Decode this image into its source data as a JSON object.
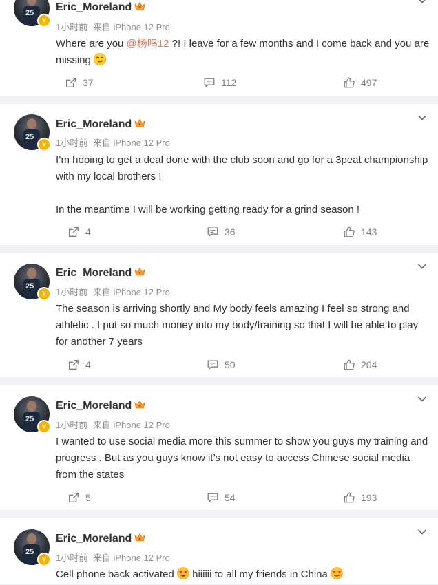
{
  "posts": [
    {
      "author": "Eric_Moreland",
      "time": "1小时前",
      "source": "来自 iPhone 12 Pro",
      "text_before": "Where are you ",
      "mention": "@杨鸣12",
      "text_after": " ?! I leave for a few months and I come back and you are missing",
      "emoji": "smirk-emoji",
      "reposts": "37",
      "comments": "112",
      "likes": "497"
    },
    {
      "author": "Eric_Moreland",
      "time": "1小时前",
      "source": "来自 iPhone 12 Pro",
      "para1": "I’m hoping to get a deal done with the club soon and go for a 3peat championship with my local brothers !",
      "para2": "In the meantime I will be working getting ready for a grind season !",
      "reposts": "4",
      "comments": "36",
      "likes": "143"
    },
    {
      "author": "Eric_Moreland",
      "time": "1小时前",
      "source": "来自 iPhone 12 Pro",
      "text": "The season is arriving shortly and My body feels amazing I feel so strong and athletic . I put so much money into my body/training so that I will be able to play for another 7 years",
      "reposts": "4",
      "comments": "50",
      "likes": "204"
    },
    {
      "author": "Eric_Moreland",
      "time": "1小时前",
      "source": "来自 iPhone 12 Pro",
      "text": "I wanted to use social media more this summer to show you guys my training and progress . But as you guys know it’s not easy to access Chinese social media from the states",
      "reposts": "5",
      "comments": "54",
      "likes": "193"
    },
    {
      "author": "Eric_Moreland",
      "time": "1小时前",
      "source": "来自 iPhone 12 Pro",
      "text_before": "Cell phone back activated ",
      "text_middle": " hiiiiii to all my friends in China ",
      "emoji1": "star-struck-emoji",
      "emoji2": "heart-eyes-emoji"
    }
  ],
  "avatar_jersey_number": "25",
  "colors": {
    "mention": "#eb7350",
    "meta": "#939393",
    "separator": "#f1f2f5"
  }
}
